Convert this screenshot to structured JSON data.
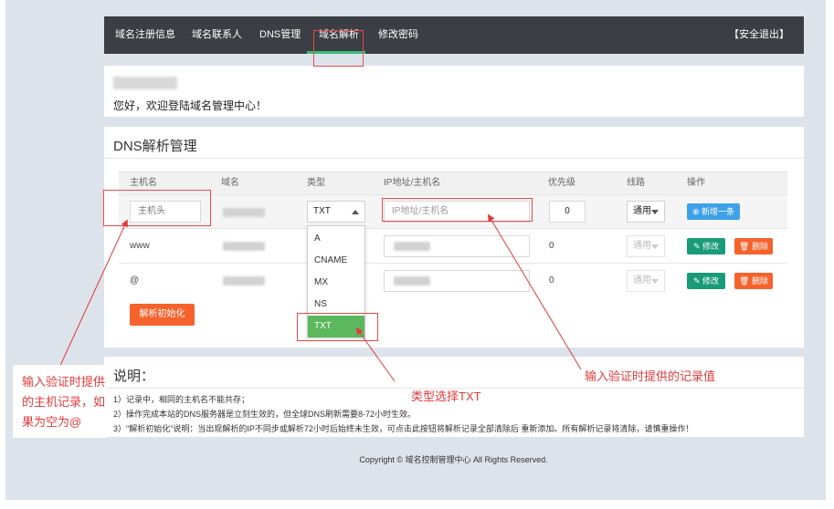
{
  "nav": {
    "items": [
      "域名注册信息",
      "域名联系人",
      "DNS管理",
      "域名解析",
      "修改密码"
    ],
    "active_index": 3,
    "logout": "【安全退出】"
  },
  "welcome": {
    "text": "您好，欢迎登陆域名管理中心！"
  },
  "dns": {
    "title": "DNS解析管理",
    "headers": [
      "主机名",
      "域名",
      "类型",
      "IP地址/主机名",
      "优先级",
      "线路",
      "操作"
    ],
    "new_row": {
      "host_placeholder": "主机头",
      "type_value": "TXT",
      "ip_placeholder": "IP地址/主机名",
      "priority": "0",
      "line": "通用",
      "add_button": "新增一条"
    },
    "rows": [
      {
        "host": "www",
        "priority": "0",
        "line": "通用",
        "edit": "修改",
        "delete": "删除"
      },
      {
        "host": "@",
        "priority": "0",
        "line": "通用",
        "edit": "修改",
        "delete": "删除"
      }
    ],
    "type_options": [
      "A",
      "CNAME",
      "MX",
      "NS",
      "TXT"
    ],
    "type_selected": "TXT",
    "init_button": "解析初始化"
  },
  "notes": {
    "title": "说明：",
    "items": [
      "1）记录中，相同的主机名不能共存；",
      "2）操作完成本站的DNS服务器是立刻生效的，但全球DNS刷新需要8-72小时生效。",
      "3）\"解析初始化\"说明：当出现解析的IP不同步或解析72小时后始终未生效，可点击此按钮将解析记录全部清除后 重新添加。所有解析记录将清除，请慎重操作！"
    ]
  },
  "footer": {
    "copyright": "Copyright © 域名控制管理中心 All Rights Reserved."
  },
  "annotations": {
    "left": [
      "输入验证时提供",
      "的主机记录，如",
      "果为空为@"
    ],
    "type": "类型选择TXT",
    "value": "输入验证时提供的记录值"
  },
  "colors": {
    "nav_bg": "#3b3e44",
    "accent_green": "#3dbb7a",
    "orange": "#f5622c",
    "blue": "#3ea1e8",
    "teal": "#1a9b78",
    "annotation_red": "#e23b3b"
  }
}
